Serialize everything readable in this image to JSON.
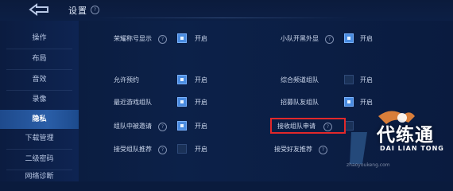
{
  "header": {
    "title": "设置",
    "help_icon": "help-icon",
    "back_icon": "back-arrow-icon"
  },
  "sidebar": {
    "items": [
      {
        "label": "操作",
        "active": false
      },
      {
        "label": "布局",
        "active": false
      },
      {
        "label": "音效",
        "active": false
      },
      {
        "label": "录像",
        "active": false
      },
      {
        "label": "隐私",
        "active": true
      },
      {
        "label": "下载管理",
        "active": false
      },
      {
        "label": "二级密码",
        "active": false
      },
      {
        "label": "网络诊断",
        "active": false
      }
    ]
  },
  "settings": {
    "on_label": "开启",
    "rows": [
      {
        "label": "荣耀称号显示",
        "checked": true,
        "has_help": true
      },
      {
        "label": "小队开黑外显",
        "checked": true,
        "has_help": true
      },
      {
        "label": "允许预约",
        "checked": true,
        "has_help": false
      },
      {
        "label": "综合频道组队",
        "checked": false,
        "has_help": false
      },
      {
        "label": "最近游戏组队",
        "checked": true,
        "has_help": false
      },
      {
        "label": "招募队友组队",
        "checked": true,
        "has_help": false
      },
      {
        "label": "组队中被邀请",
        "checked": true,
        "has_help": true
      },
      {
        "label": "接收组队申请",
        "checked": false,
        "has_help": true,
        "highlighted": true
      },
      {
        "label": "接受组队推荐",
        "checked": false,
        "has_help": true
      },
      {
        "label": "接受好友推荐",
        "checked": false,
        "has_help": true
      }
    ]
  },
  "colors": {
    "background": "#0c2149",
    "active_tab": "#2a5ea8",
    "checkbox_on": "#4a8ce0",
    "highlight": "#e2282a"
  },
  "watermark": {
    "main": "代练通",
    "sub": "DAI LIAN TONG",
    "url": "zhaoyoukeng.com"
  }
}
